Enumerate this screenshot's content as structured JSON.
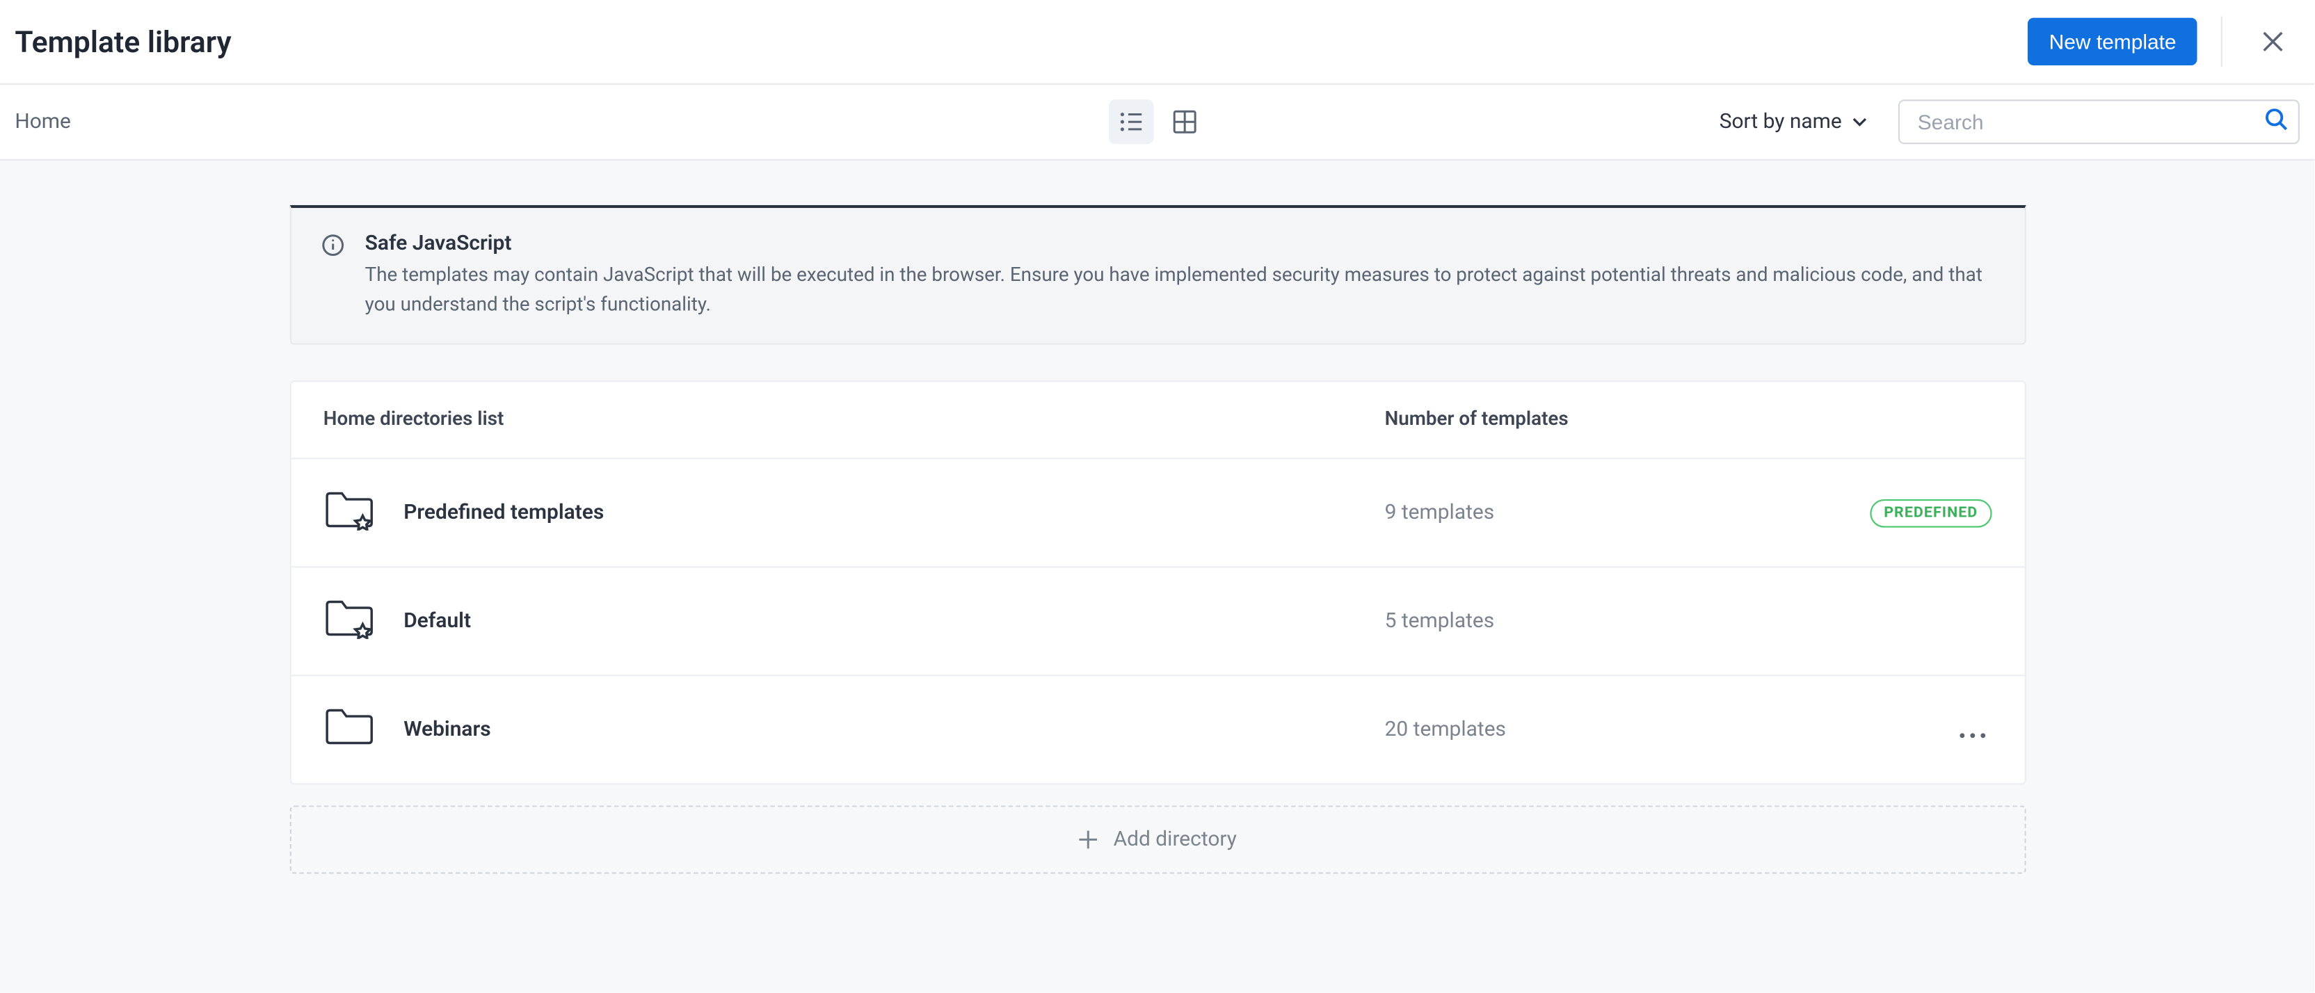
{
  "header": {
    "title": "Template library",
    "new_template_label": "New template"
  },
  "toolbar": {
    "breadcrumb": "Home",
    "sort_label": "Sort by name",
    "search_placeholder": "Search"
  },
  "alert": {
    "title": "Safe JavaScript",
    "text": "The templates may contain JavaScript that will be executed in the browser. Ensure you have implemented security measures to protect against potential threats and malicious code, and that you understand the script's functionality."
  },
  "table": {
    "header_name": "Home directories list",
    "header_count": "Number of templates",
    "rows": [
      {
        "name": "Predefined templates",
        "count": "9 templates",
        "badge": "PREDEFINED",
        "starred": true,
        "more": false
      },
      {
        "name": "Default",
        "count": "5 templates",
        "badge": null,
        "starred": true,
        "more": false
      },
      {
        "name": "Webinars",
        "count": "20 templates",
        "badge": null,
        "starred": false,
        "more": true
      }
    ]
  },
  "add_directory_label": "Add directory"
}
